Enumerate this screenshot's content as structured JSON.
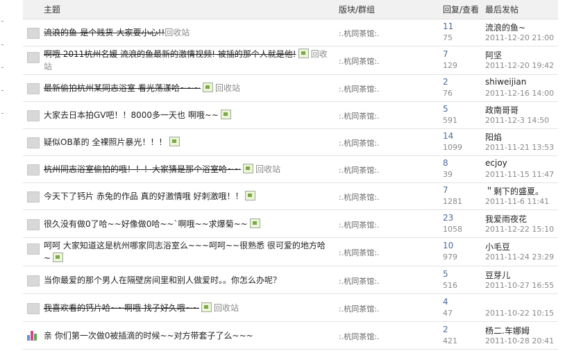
{
  "header": {
    "subject": "主题",
    "forum": "版块/群组",
    "replies_views": "回复/查看",
    "last_post": "最后发帖"
  },
  "rows": [
    {
      "title": "流浪的鱼-是个贱货-大家要小心!!",
      "strike": true,
      "image": false,
      "tail": "回收站",
      "forum": ":.杭同茶馆:.",
      "replies": "11",
      "views": "75",
      "user": "流浪的鱼~",
      "date": "2011-12-20 21:00",
      "icon": "folder-icon"
    },
    {
      "title": "啊哦 2011杭州名媛 流浪的鱼最新的激情视频! 被插的那个人就是他!",
      "strike": true,
      "image": true,
      "tail": "回收站",
      "forum": ":.杭同茶馆:.",
      "replies": "7",
      "views": "129",
      "user": "阿坚",
      "date": "2011-12-20 19:42",
      "icon": "folder-icon"
    },
    {
      "title": "最新偷拍杭州某同志浴室 看光荡漾哈~~~",
      "strike": true,
      "image": true,
      "tail": "回收站",
      "forum": ":.杭同茶馆:.",
      "replies": "2",
      "views": "76",
      "user": "shiweijian",
      "date": "2011-12-16 14:00",
      "icon": "folder-icon"
    },
    {
      "title": "大家去日本拍GV吧！！8000多一天也 啊哦~~",
      "strike": false,
      "image": true,
      "tail": "",
      "forum": ":.杭同茶馆:.",
      "replies": "5",
      "views": "591",
      "user": "政南哥哥",
      "date": "2011-12-3 14:50",
      "icon": "folder-icon"
    },
    {
      "title": "疑似OB革的 全裸照片暴光！！！",
      "strike": false,
      "image": true,
      "tail": "",
      "forum": ":.杭同茶馆:.",
      "replies": "14",
      "views": "1099",
      "user": "阳焰",
      "date": "2011-11-21 13:53",
      "icon": "folder-icon"
    },
    {
      "title": "杭州同志浴室偷拍的哦！！！大家猜是那个浴室哈~~",
      "strike": true,
      "image": true,
      "tail": "回收站",
      "forum": ":.杭同茶馆:.",
      "replies": "8",
      "views": "39",
      "user": "ecjoy",
      "date": "2011-11-15 11:47",
      "icon": "folder-icon"
    },
    {
      "title": "今天下了钙片 赤兔的作品 真的好激情哦 好刺激哦！！",
      "strike": false,
      "image": true,
      "tail": "",
      "forum": ":.杭同茶馆:.",
      "replies": "7",
      "views": "1281",
      "user": "＂剩下的盛夏。",
      "date": "2011-11-6 11:41",
      "icon": "folder-icon"
    },
    {
      "title": "很久没有做0了哈~~好像做0哈~~`啊哦~~求爆菊~~",
      "strike": false,
      "image": true,
      "tail": "",
      "forum": ":.杭同茶馆:.",
      "replies": "23",
      "views": "1058",
      "user": "我爱雨夜花",
      "date": "2011-12-22 15:10",
      "icon": "folder-icon"
    },
    {
      "title": "呵呵 大家知道这是杭州哪家同志浴室么~~~呵呵~~很熟悉 很可爱的地方哈~",
      "strike": false,
      "image": true,
      "tail": "",
      "forum": ":.杭同茶馆:.",
      "replies": "10",
      "views": "979",
      "user": "小毛豆",
      "date": "2011-11-24 23:29",
      "icon": "folder-icon"
    },
    {
      "title": "当你最爱的那个男人在隔壁房间里和别人做爱时。。你怎么办呢？",
      "strike": false,
      "image": false,
      "tail": "",
      "forum": ":.杭同茶馆:.",
      "replies": "5",
      "views": "516",
      "user": "豆芽儿",
      "date": "2011-10-27 16:55",
      "icon": "folder-icon"
    },
    {
      "title": "我喜欢看的钙片哈~~啊哦 找子好久哦~~",
      "strike": true,
      "image": true,
      "tail": "回收站",
      "forum": ":.杭同茶馆:.",
      "replies": "4",
      "views": "47",
      "user": "",
      "date": "2011-10-22 10:15",
      "icon": "folder-icon"
    },
    {
      "title": "亲 你们第一次做0被插滴的时候~~对方带套子了么~~~",
      "strike": false,
      "image": false,
      "tail": "",
      "forum": ":.杭同茶馆:.",
      "replies": "2",
      "views": "421",
      "user": "杨二.车娜姆",
      "date": "2011-10-28 20:41",
      "icon": "poll-chart-icon"
    }
  ],
  "colors": {
    "header_bg": "#f1f1f1",
    "reply_link": "#4a6a9a",
    "muted": "#888888"
  }
}
